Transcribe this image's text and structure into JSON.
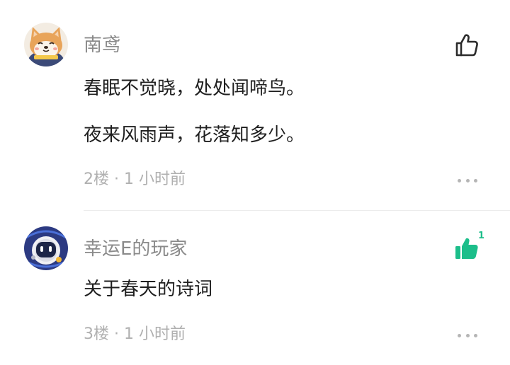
{
  "comments": [
    {
      "username": "南鸢",
      "lines": [
        "春眠不觉晓，处处闻啼鸟。",
        "夜来风雨声，花落知多少。"
      ],
      "meta": "2楼 · 1 小时前",
      "liked": false,
      "like_count": null,
      "avatar_icon": "shiba-dog-avatar-icon"
    },
    {
      "username": "幸运E的玩家",
      "lines": [
        "关于春天的诗词"
      ],
      "meta": "3楼 · 1 小时前",
      "liked": true,
      "like_count": "1",
      "avatar_icon": "robot-avatar-icon"
    }
  ],
  "colors": {
    "liked_accent": "#1cbe8a",
    "username": "#8a8a8a",
    "body_text": "#1f1f1f",
    "meta_text": "#b0b0b0"
  }
}
